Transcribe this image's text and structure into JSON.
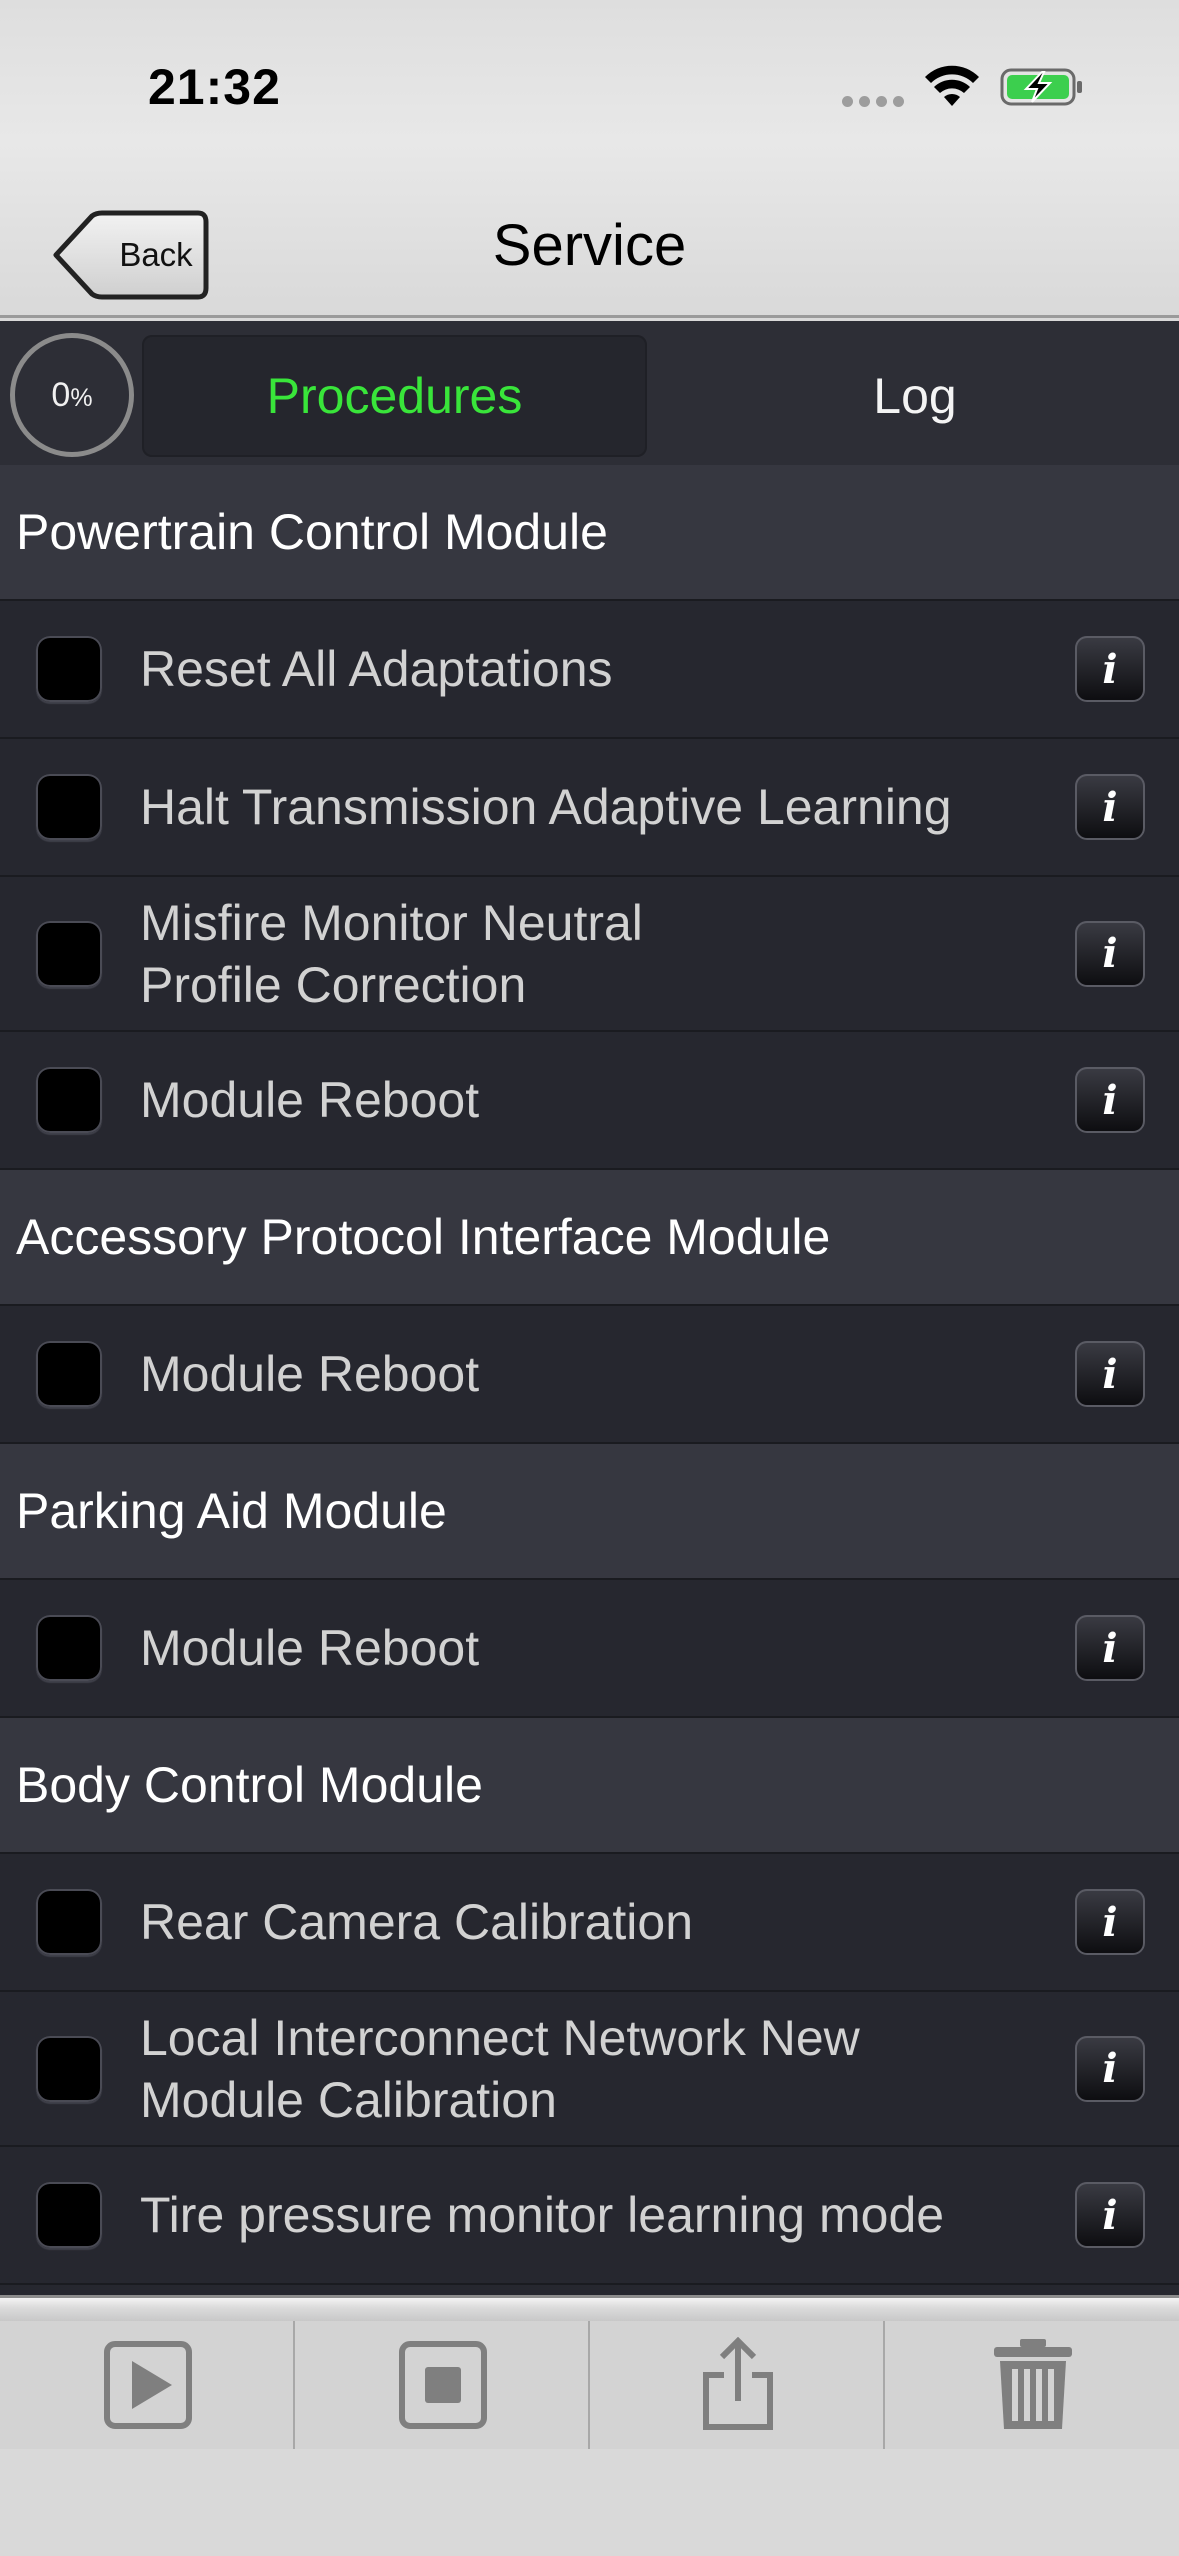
{
  "status_bar": {
    "time": "21:32"
  },
  "nav": {
    "back_label": "Back",
    "title": "Service"
  },
  "segments": {
    "progress_value": "0",
    "progress_unit": "%",
    "procedures_label": "Procedures",
    "log_label": "Log",
    "active_color": "#39e53a"
  },
  "sections": [
    {
      "title": "Powertrain Control Module",
      "items": [
        {
          "label": "Reset All Adaptations"
        },
        {
          "label": "Halt Transmission Adaptive Learning"
        },
        {
          "label": "Misfire Monitor Neutral Profile Correction"
        },
        {
          "label": "Module Reboot"
        }
      ]
    },
    {
      "title": "Accessory Protocol Interface Module",
      "items": [
        {
          "label": "Module Reboot"
        }
      ]
    },
    {
      "title": "Parking Aid Module",
      "items": [
        {
          "label": "Module Reboot"
        }
      ]
    },
    {
      "title": "Body Control Module",
      "items": [
        {
          "label": "Rear Camera Calibration"
        },
        {
          "label": "Local Interconnect Network New Module Calibration"
        },
        {
          "label": "Tire pressure monitor learning mode"
        }
      ]
    }
  ],
  "info_glyph": "i",
  "toolbar": {
    "icons": [
      "play-icon",
      "stop-icon",
      "share-icon",
      "trash-icon"
    ]
  }
}
